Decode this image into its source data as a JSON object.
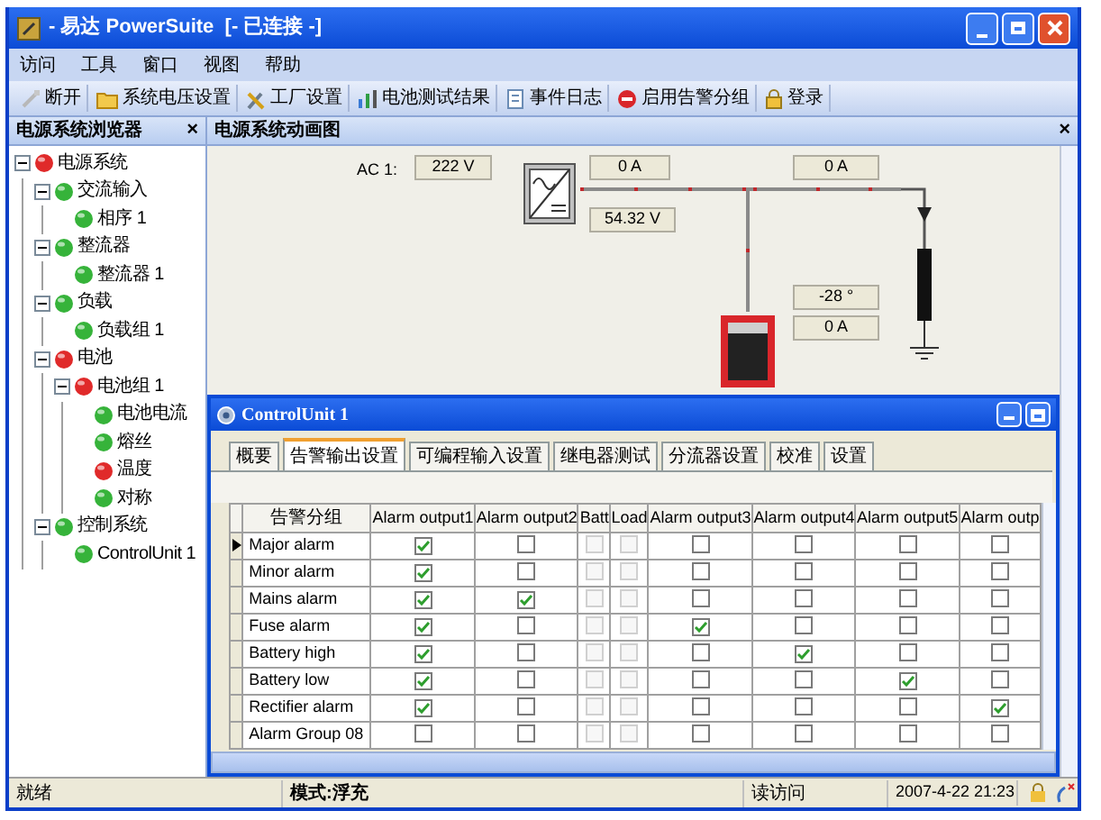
{
  "window": {
    "title": "- 易达 PowerSuite  [- 已连接 -]"
  },
  "menu": [
    "访问",
    "工具",
    "窗口",
    "视图",
    "帮助"
  ],
  "toolbar": [
    {
      "label": "断开",
      "kind": "plug"
    },
    {
      "label": "系统电压设置",
      "kind": "folder"
    },
    {
      "label": "工厂设置",
      "kind": "tools"
    },
    {
      "label": "电池测试结果",
      "kind": "chart"
    },
    {
      "label": "事件日志",
      "kind": "log"
    },
    {
      "label": "启用告警分组",
      "kind": "alarm"
    },
    {
      "label": "登录",
      "kind": "lock"
    }
  ],
  "browser": {
    "title": "电源系统浏览器",
    "close": "×",
    "tree": [
      {
        "label": "电源系统",
        "color": "#e02a2a",
        "expanded": true,
        "children": [
          {
            "label": "交流输入",
            "color": "#36b33a",
            "expanded": true,
            "children": [
              {
                "label": "相序 1",
                "color": "#36b33a"
              }
            ]
          },
          {
            "label": "整流器",
            "color": "#36b33a",
            "expanded": true,
            "children": [
              {
                "label": "整流器 1",
                "color": "#36b33a"
              }
            ]
          },
          {
            "label": "负载",
            "color": "#36b33a",
            "expanded": true,
            "children": [
              {
                "label": "负载组 1",
                "color": "#36b33a"
              }
            ]
          },
          {
            "label": "电池",
            "color": "#e02a2a",
            "expanded": true,
            "children": [
              {
                "label": "电池组 1",
                "color": "#e02a2a",
                "expanded": true,
                "children": [
                  {
                    "label": "电池电流",
                    "color": "#36b33a"
                  },
                  {
                    "label": "熔丝",
                    "color": "#36b33a"
                  },
                  {
                    "label": "温度",
                    "color": "#e02a2a"
                  },
                  {
                    "label": "对称",
                    "color": "#36b33a"
                  }
                ]
              }
            ]
          },
          {
            "label": "控制系统",
            "color": "#36b33a",
            "expanded": true,
            "children": [
              {
                "label": "ControlUnit 1",
                "color": "#36b33a"
              }
            ]
          }
        ]
      }
    ]
  },
  "diagram": {
    "title": "电源系统动画图",
    "close": "×",
    "ac_label": "AC 1:",
    "ac_voltage": "222 V",
    "rectifier_current": "0 A",
    "bus_voltage": "54.32 V",
    "load_current": "0 A",
    "battery_temperature": "-28 °",
    "battery_current": "0 A"
  },
  "control_unit": {
    "title": "ControlUnit 1",
    "tabs": [
      {
        "label": "概要",
        "selected": false
      },
      {
        "label": "告警输出设置",
        "selected": true
      },
      {
        "label": "可编程输入设置",
        "selected": false
      },
      {
        "label": "继电器测试",
        "selected": false
      },
      {
        "label": "分流器设置",
        "selected": false
      },
      {
        "label": "校准",
        "selected": false
      },
      {
        "label": "设置",
        "selected": false
      }
    ],
    "columns": [
      {
        "label": "告警分组"
      },
      {
        "label": "Alarm output1",
        "disabled": false
      },
      {
        "label": "Alarm output2",
        "disabled": false
      },
      {
        "label": "Batt",
        "disabled": true
      },
      {
        "label": "Load",
        "disabled": true
      },
      {
        "label": "Alarm output3",
        "disabled": false
      },
      {
        "label": "Alarm output4",
        "disabled": false
      },
      {
        "label": "Alarm output5",
        "disabled": false
      },
      {
        "label": "Alarm outp",
        "disabled": false
      }
    ],
    "rows": [
      {
        "name": "Major alarm",
        "selected": true,
        "checked": [
          true,
          false,
          false,
          false,
          false,
          false,
          false,
          false
        ]
      },
      {
        "name": "Minor alarm",
        "selected": false,
        "checked": [
          true,
          false,
          false,
          false,
          false,
          false,
          false,
          false
        ]
      },
      {
        "name": "Mains alarm",
        "selected": false,
        "checked": [
          true,
          true,
          false,
          false,
          false,
          false,
          false,
          false
        ]
      },
      {
        "name": "Fuse alarm",
        "selected": false,
        "checked": [
          true,
          false,
          false,
          false,
          true,
          false,
          false,
          false
        ]
      },
      {
        "name": "Battery high",
        "selected": false,
        "checked": [
          true,
          false,
          false,
          false,
          false,
          true,
          false,
          false
        ]
      },
      {
        "name": "Battery low",
        "selected": false,
        "checked": [
          true,
          false,
          false,
          false,
          false,
          false,
          true,
          false
        ]
      },
      {
        "name": "Rectifier alarm",
        "selected": false,
        "checked": [
          true,
          false,
          false,
          false,
          false,
          false,
          false,
          true
        ]
      },
      {
        "name": "Alarm Group 08",
        "selected": false,
        "checked": [
          false,
          false,
          false,
          false,
          false,
          false,
          false,
          false
        ]
      }
    ]
  },
  "status_bar": {
    "state": "就绪",
    "mode": "模式:浮充",
    "access": "读访问",
    "datetime": "2007-4-22 21:23"
  }
}
